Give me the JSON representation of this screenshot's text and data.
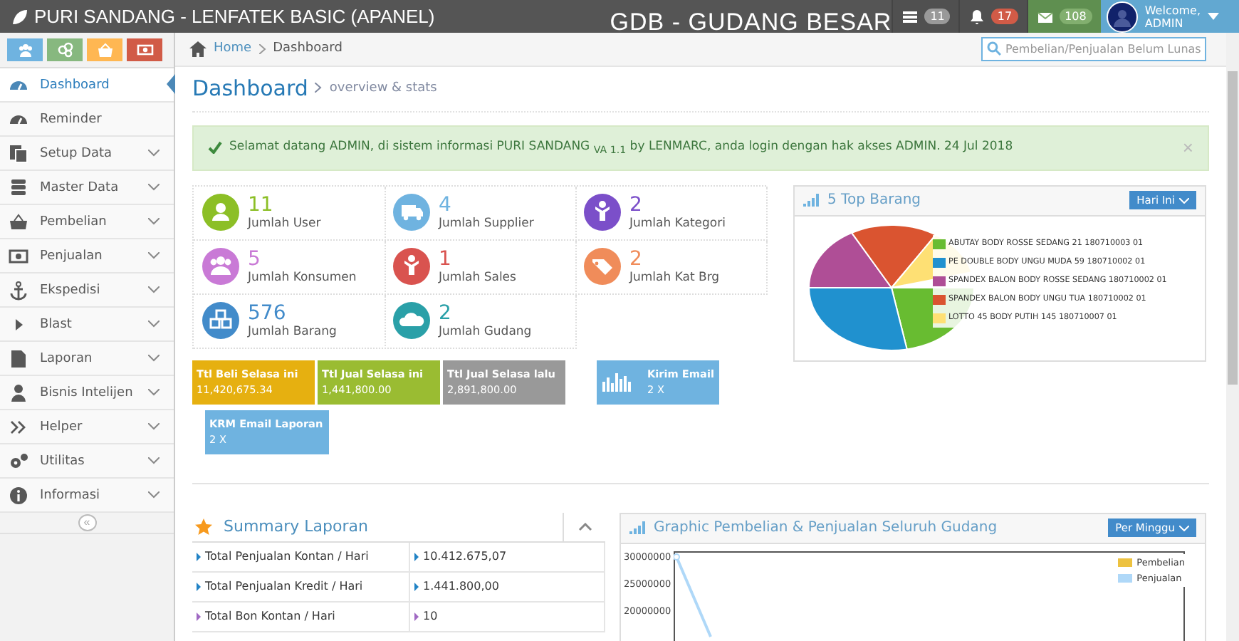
{
  "header": {
    "brand": "PURI SANDANG - LENFATEK BASIC (APANEL)",
    "warehouse": "GDB - GUDANG BESAR",
    "badges": [
      {
        "kind": "tasks",
        "count": "11",
        "color": "#999999"
      },
      {
        "kind": "notifications",
        "count": "17",
        "color": "#d15b47"
      },
      {
        "kind": "messages",
        "count": "108",
        "color": "#82af6f"
      }
    ],
    "user": {
      "greeting": "Welcome,",
      "name": "ADMIN"
    }
  },
  "shortcuts": [
    {
      "kind": "users",
      "color": "#6fb3e0"
    },
    {
      "kind": "share",
      "color": "#87b87f"
    },
    {
      "kind": "basket",
      "color": "#ffb752"
    },
    {
      "kind": "money",
      "color": "#d15b47"
    }
  ],
  "breadcrumb": [
    "Home",
    "Dashboard"
  ],
  "search": {
    "placeholder": "Pembelian/Penjualan Belum Lunas"
  },
  "sidebar": {
    "items": [
      {
        "label": "Dashboard",
        "kind": "dashboard",
        "selected": true,
        "expandable": false
      },
      {
        "label": "Reminder",
        "kind": "dashboard",
        "selected": false,
        "expandable": false
      },
      {
        "label": "Setup Data",
        "kind": "copy",
        "selected": false,
        "expandable": true
      },
      {
        "label": "Master Data",
        "kind": "database",
        "selected": false,
        "expandable": true
      },
      {
        "label": "Pembelian",
        "kind": "basket",
        "selected": false,
        "expandable": true
      },
      {
        "label": "Penjualan",
        "kind": "money",
        "selected": false,
        "expandable": true
      },
      {
        "label": "Ekspedisi",
        "kind": "anchor",
        "selected": false,
        "expandable": true
      },
      {
        "label": "Blast",
        "kind": "play",
        "selected": false,
        "expandable": true
      },
      {
        "label": "Laporan",
        "kind": "file",
        "selected": false,
        "expandable": true
      },
      {
        "label": "Bisnis Intelijen",
        "kind": "user",
        "selected": false,
        "expandable": true
      },
      {
        "label": "Helper",
        "kind": "double",
        "selected": false,
        "expandable": true
      },
      {
        "label": "Utilitas",
        "kind": "gears",
        "selected": false,
        "expandable": true
      },
      {
        "label": "Informasi",
        "kind": "info",
        "selected": false,
        "expandable": true
      }
    ],
    "collapse": "«"
  },
  "page": {
    "title": "Dashboard",
    "subtitle": "overview & stats"
  },
  "alert": {
    "text": "Selamat datang ADMIN, di sistem informasi PURI SANDANG $_{VA 1.1}$ by LENMARC, anda login dengan hak akses ADMIN. 24 Jul 2018",
    "close": "×"
  },
  "stats": [
    {
      "value": "11",
      "label": "Jumlah User",
      "kind": "user",
      "color": "#8cbf26"
    },
    {
      "value": "4",
      "label": "Jumlah Supplier",
      "kind": "truck",
      "color": "#6fb3e0"
    },
    {
      "value": "2",
      "label": "Jumlah Kategori",
      "kind": "person",
      "color": "#7b4fc9"
    },
    {
      "value": "5",
      "label": "Jumlah Konsumen",
      "kind": "users",
      "color": "#c97ad6"
    },
    {
      "value": "1",
      "label": "Jumlah Sales",
      "kind": "person",
      "color": "#d9534f"
    },
    {
      "value": "2",
      "label": "Jumlah Kat Brg",
      "kind": "tag",
      "color": "#f08c5a"
    },
    {
      "value": "576",
      "label": "Jumlah Barang",
      "kind": "cubes",
      "color": "#428bca"
    },
    {
      "value": "2",
      "label": "Jumlah Gudang",
      "kind": "cloud",
      "color": "#2aa0a8"
    }
  ],
  "tiles": [
    {
      "title": "Ttl Beli Selasa ini",
      "value": "11,420,675.34",
      "kind": "plain",
      "color": "#e6b010"
    },
    {
      "title": "Ttl Jual Selasa ini",
      "value": "1,441,800.00",
      "kind": "plain",
      "color": "#9abc32"
    },
    {
      "title": "Ttl Jual Selasa lalu",
      "value": "2,891,800.00",
      "kind": "plain",
      "color": "#999999"
    },
    {
      "title": "Kirim Email",
      "value": "2 X",
      "kind": "chart",
      "color": "#6fb3e0"
    },
    {
      "title": "KRM Email Laporan",
      "value": "2 X",
      "kind": "plain",
      "color": "#6fb3e0"
    }
  ],
  "top_barang": {
    "title": "5 Top Barang",
    "filter": "Hari Ini",
    "items": [
      {
        "label": "ABUTAY BODY ROSSE SEDANG 21 180710003 01",
        "color": "#68bc31"
      },
      {
        "label": "PE DOUBLE BODY UNGU MUDA 59 180710002 01",
        "color": "#2091cf"
      },
      {
        "label": "SPANDEX BALON BODY ROSSE SEDANG 180710002 01",
        "color": "#af4e96"
      },
      {
        "label": "SPANDEX BALON BODY UNGU TUA 180710002 01",
        "color": "#da5430"
      },
      {
        "label": "LOTTO 45 BODY PUTIH 145 180710007 01",
        "color": "#fee074"
      }
    ]
  },
  "summary": {
    "title": "Summary Laporan",
    "rows": [
      {
        "label": "Total Penjualan Kontan / Hari",
        "value": "10.412.675,07",
        "color": "#2283c5"
      },
      {
        "label": "Total Penjualan Kredit / Hari",
        "value": "1.441.800,00",
        "color": "#2283c5"
      },
      {
        "label": "Total Bon Kontan / Hari",
        "value": "10",
        "color": "#a069c3"
      }
    ]
  },
  "graphic": {
    "title": "Graphic Pembelian & Penjualan Seluruh Gudang",
    "filter": "Per Minggu",
    "y_labels": [
      "30000000",
      "25000000",
      "20000000"
    ],
    "legend": [
      {
        "name": "Pembelian",
        "color": "#edc240"
      },
      {
        "name": "Penjualan",
        "color": "#afd8f8"
      }
    ]
  }
}
